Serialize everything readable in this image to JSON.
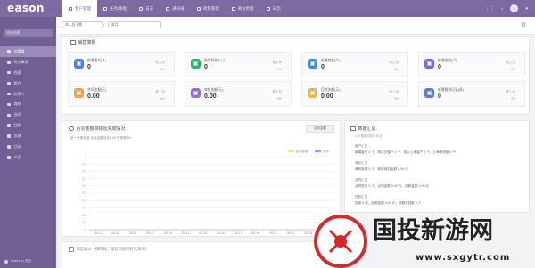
{
  "app": {
    "logo": "eason",
    "nav": [
      {
        "label": "客户管理",
        "icon": "users-icon",
        "active": true
      },
      {
        "label": "任务/审批",
        "icon": "task-icon",
        "active": false
      },
      {
        "label": "日志",
        "icon": "log-icon",
        "active": false
      },
      {
        "label": "通讯录",
        "icon": "contacts-icon",
        "active": false
      },
      {
        "label": "项目管理",
        "icon": "project-icon",
        "active": false
      },
      {
        "label": "商业智能",
        "icon": "bi-icon",
        "active": false
      },
      {
        "label": "日历",
        "icon": "calendar-icon",
        "active": false
      }
    ],
    "user_initial": "Y"
  },
  "sidebar": {
    "search_placeholder": "快速创建",
    "items": [
      {
        "label": "仪表盘",
        "active": true
      },
      {
        "label": "待办事项",
        "active": false
      },
      {
        "label": "线索",
        "active": false
      },
      {
        "label": "客户",
        "active": false
      },
      {
        "label": "联系人",
        "active": false
      },
      {
        "label": "商机",
        "active": false
      },
      {
        "label": "合同",
        "active": false
      },
      {
        "label": "回款",
        "active": false
      },
      {
        "label": "发票",
        "active": false
      },
      {
        "label": "回访",
        "active": false
      },
      {
        "label": "产品",
        "active": false
      }
    ],
    "footer": "Power by 悟空"
  },
  "subbar": {
    "scope_select": "本人及下属",
    "date_select": "本月"
  },
  "overview": {
    "title": "销售简报",
    "cards": [
      {
        "label": "新增客户(人)",
        "value": "0",
        "compare": "较上月",
        "pct": "0%",
        "color": "#4a7ee8",
        "icon": "user-icon"
      },
      {
        "label": "新增联系人(人)",
        "value": "0",
        "compare": "较上月",
        "pct": "0%",
        "color": "#2fb36a",
        "icon": "contact-icon"
      },
      {
        "label": "新增商机(个)",
        "value": "0",
        "compare": "较上月",
        "pct": "0%",
        "color": "#3b8fe0",
        "icon": "business-icon"
      },
      {
        "label": "新增合同(个)",
        "value": "0",
        "compare": "较上月",
        "pct": "0%",
        "color": "#6b6fd8",
        "icon": "contract-icon"
      },
      {
        "label": "合同金额(元)",
        "value": "0.00",
        "compare": "较上月",
        "pct": "0%",
        "color": "#f0a43a",
        "icon": "money-icon"
      },
      {
        "label": "商机金额(元)",
        "value": "0.00",
        "compare": "较上月",
        "pct": "0%",
        "color": "#9c6ad8",
        "icon": "opportunity-icon"
      },
      {
        "label": "回款金额(元)",
        "value": "0.00",
        "compare": "较上月",
        "pct": "0%",
        "color": "#f0b43a",
        "icon": "payment-icon"
      },
      {
        "label": "新增跟进记录(条)",
        "value": "0",
        "compare": "较上月",
        "pct": "0%",
        "color": "#5a7ed8",
        "icon": "followup-icon"
      }
    ]
  },
  "chart_card": {
    "title": "合同金额目标及完成情况",
    "button": "合同金额",
    "subtitle": "统一考核标准 全年金额目标0.00 完成率0%",
    "legend": [
      "合同金额",
      "目标"
    ]
  },
  "chart_data": {
    "type": "bar",
    "categories": [
      "09-01",
      "09-03",
      "09-05",
      "09-07",
      "09-09",
      "09-11",
      "09-13",
      "09-15",
      "09-17",
      "09-19",
      "09-21",
      "09-23",
      "09-25",
      "09-27"
    ],
    "series": [
      {
        "name": "合同金额",
        "values": [
          0,
          0,
          0,
          0,
          0,
          0,
          0,
          0,
          0,
          0,
          0,
          0,
          0,
          0
        ],
        "color": "#f5e08a"
      },
      {
        "name": "目标",
        "values": [
          0,
          0,
          0,
          0,
          0,
          0,
          0,
          0,
          0,
          0,
          0,
          0,
          0,
          0
        ],
        "color": "#7aa7e8"
      }
    ],
    "ylim": [
      0,
      1
    ],
    "yticks": [
      "0",
      "0.1",
      "0.2",
      "0.3",
      "0.4",
      "0.5",
      "0.6",
      "0.7",
      "0.8",
      "0.9",
      "1"
    ],
    "grid": true,
    "legend_position": "top-right"
  },
  "data_summary": {
    "title": "数据汇总",
    "subtitle": "以下数据仅统计本月",
    "blocks": [
      {
        "heading": "客户汇总",
        "line": "新增客户 0 个，转成交客户 0 个，放入公海客户 0 个，公海池领取 0 个"
      },
      {
        "heading": "商机汇总",
        "line": "商机新增 0 个，新增商机金额 0.00 元"
      },
      {
        "heading": "合同汇总",
        "line": "合同签约 0 个，合同金额 0.00 元，回款金额 0.00 元"
      },
      {
        "heading": "回款汇总",
        "line": "回款 0 笔，回款金额 0.00 元，超期未回款 0 个"
      }
    ]
  },
  "bottom_card": {
    "title": "销售漏斗（按阶段，销售流程的转化情况）"
  },
  "watermark": {
    "text_cn": "国投新游网",
    "text_url": "www.sxgytr.com"
  }
}
